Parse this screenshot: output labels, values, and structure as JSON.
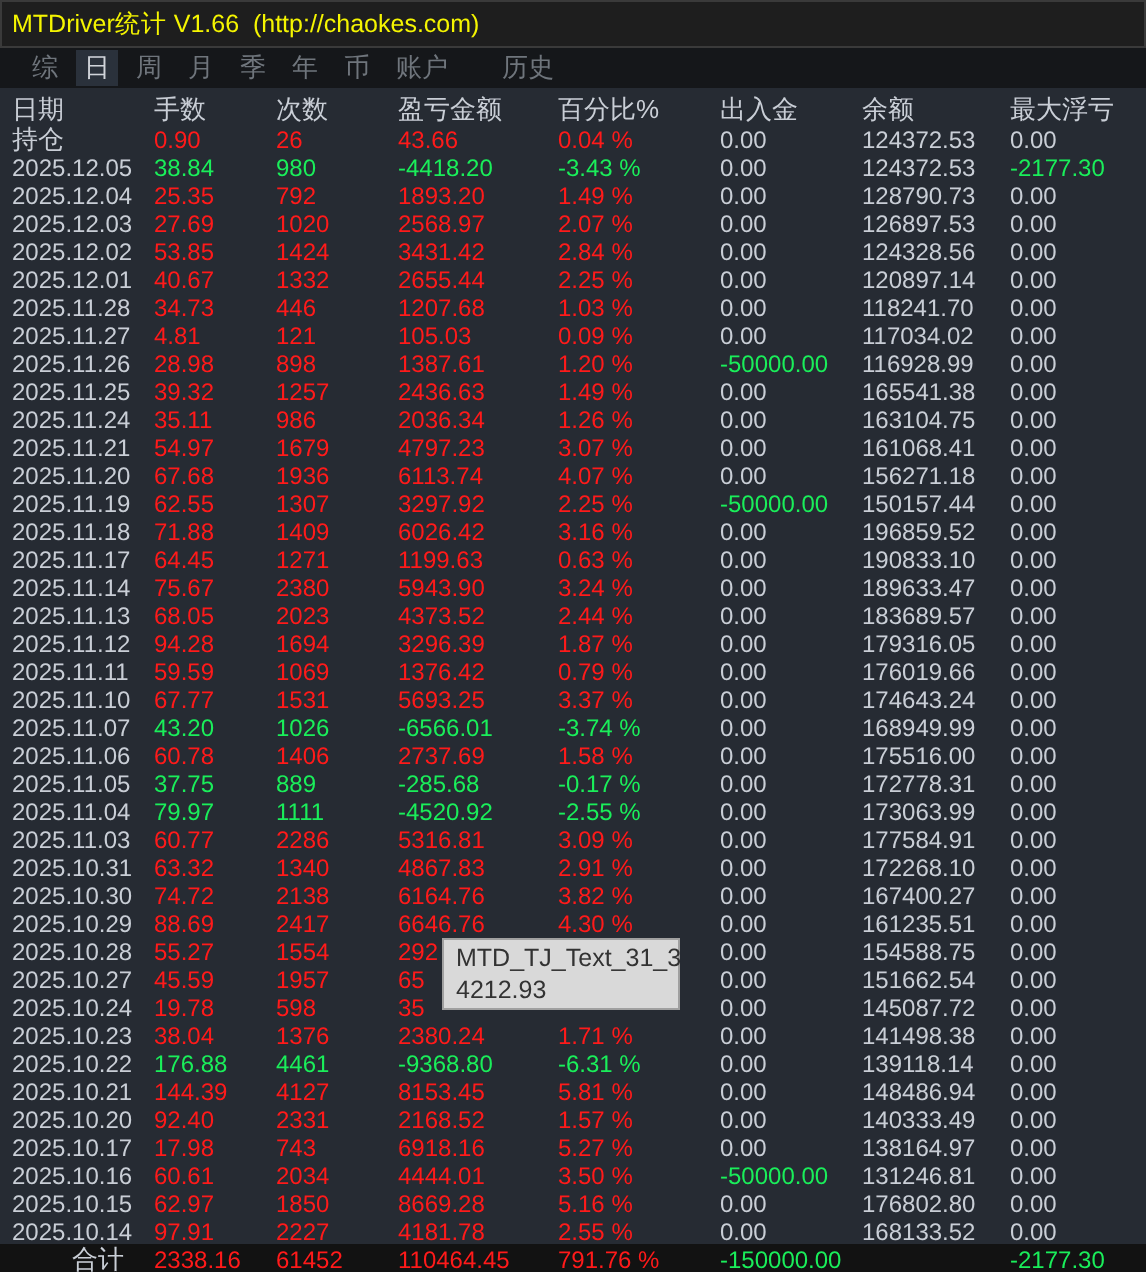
{
  "window": {
    "title": "MTDriver统计 V1.66  (http://chaokes.com)"
  },
  "tabs": [
    {
      "label": "综",
      "selected": false
    },
    {
      "label": "日",
      "selected": true
    },
    {
      "label": "周",
      "selected": false
    },
    {
      "label": "月",
      "selected": false
    },
    {
      "label": "季",
      "selected": false
    },
    {
      "label": "年",
      "selected": false
    },
    {
      "label": "币",
      "selected": false
    },
    {
      "label": "账户",
      "selected": false
    },
    {
      "label": "历史",
      "selected": false
    }
  ],
  "table": {
    "columns": [
      "日期",
      "手数",
      "次数",
      "盈亏金额",
      "百分比%",
      "出入金",
      "余额",
      "最大浮亏"
    ],
    "position": {
      "label": "持仓",
      "lots": "0.90",
      "trades": "26",
      "pnl": "43.66",
      "pct": "0.04 %",
      "cash": "0.00",
      "balance": "124372.53",
      "max_float": "0.00",
      "loss": false
    },
    "rows": [
      {
        "date": "2025.12.05",
        "lots": "38.84",
        "trades": "980",
        "pnl": "-4418.20",
        "pct": "-3.43 %",
        "cash": "0.00",
        "balance": "124372.53",
        "max_float": "-2177.30",
        "loss": true,
        "cash_negative": false,
        "float_negative": true
      },
      {
        "date": "2025.12.04",
        "lots": "25.35",
        "trades": "792",
        "pnl": "1893.20",
        "pct": "1.49 %",
        "cash": "0.00",
        "balance": "128790.73",
        "max_float": "0.00",
        "loss": false,
        "cash_negative": false,
        "float_negative": false
      },
      {
        "date": "2025.12.03",
        "lots": "27.69",
        "trades": "1020",
        "pnl": "2568.97",
        "pct": "2.07 %",
        "cash": "0.00",
        "balance": "126897.53",
        "max_float": "0.00",
        "loss": false,
        "cash_negative": false,
        "float_negative": false
      },
      {
        "date": "2025.12.02",
        "lots": "53.85",
        "trades": "1424",
        "pnl": "3431.42",
        "pct": "2.84 %",
        "cash": "0.00",
        "balance": "124328.56",
        "max_float": "0.00",
        "loss": false,
        "cash_negative": false,
        "float_negative": false
      },
      {
        "date": "2025.12.01",
        "lots": "40.67",
        "trades": "1332",
        "pnl": "2655.44",
        "pct": "2.25 %",
        "cash": "0.00",
        "balance": "120897.14",
        "max_float": "0.00",
        "loss": false,
        "cash_negative": false,
        "float_negative": false
      },
      {
        "date": "2025.11.28",
        "lots": "34.73",
        "trades": "446",
        "pnl": "1207.68",
        "pct": "1.03 %",
        "cash": "0.00",
        "balance": "118241.70",
        "max_float": "0.00",
        "loss": false,
        "cash_negative": false,
        "float_negative": false
      },
      {
        "date": "2025.11.27",
        "lots": "4.81",
        "trades": "121",
        "pnl": "105.03",
        "pct": "0.09 %",
        "cash": "0.00",
        "balance": "117034.02",
        "max_float": "0.00",
        "loss": false,
        "cash_negative": false,
        "float_negative": false
      },
      {
        "date": "2025.11.26",
        "lots": "28.98",
        "trades": "898",
        "pnl": "1387.61",
        "pct": "1.20 %",
        "cash": "-50000.00",
        "balance": "116928.99",
        "max_float": "0.00",
        "loss": false,
        "cash_negative": true,
        "float_negative": false
      },
      {
        "date": "2025.11.25",
        "lots": "39.32",
        "trades": "1257",
        "pnl": "2436.63",
        "pct": "1.49 %",
        "cash": "0.00",
        "balance": "165541.38",
        "max_float": "0.00",
        "loss": false,
        "cash_negative": false,
        "float_negative": false
      },
      {
        "date": "2025.11.24",
        "lots": "35.11",
        "trades": "986",
        "pnl": "2036.34",
        "pct": "1.26 %",
        "cash": "0.00",
        "balance": "163104.75",
        "max_float": "0.00",
        "loss": false,
        "cash_negative": false,
        "float_negative": false
      },
      {
        "date": "2025.11.21",
        "lots": "54.97",
        "trades": "1679",
        "pnl": "4797.23",
        "pct": "3.07 %",
        "cash": "0.00",
        "balance": "161068.41",
        "max_float": "0.00",
        "loss": false,
        "cash_negative": false,
        "float_negative": false
      },
      {
        "date": "2025.11.20",
        "lots": "67.68",
        "trades": "1936",
        "pnl": "6113.74",
        "pct": "4.07 %",
        "cash": "0.00",
        "balance": "156271.18",
        "max_float": "0.00",
        "loss": false,
        "cash_negative": false,
        "float_negative": false
      },
      {
        "date": "2025.11.19",
        "lots": "62.55",
        "trades": "1307",
        "pnl": "3297.92",
        "pct": "2.25 %",
        "cash": "-50000.00",
        "balance": "150157.44",
        "max_float": "0.00",
        "loss": false,
        "cash_negative": true,
        "float_negative": false
      },
      {
        "date": "2025.11.18",
        "lots": "71.88",
        "trades": "1409",
        "pnl": "6026.42",
        "pct": "3.16 %",
        "cash": "0.00",
        "balance": "196859.52",
        "max_float": "0.00",
        "loss": false,
        "cash_negative": false,
        "float_negative": false
      },
      {
        "date": "2025.11.17",
        "lots": "64.45",
        "trades": "1271",
        "pnl": "1199.63",
        "pct": "0.63 %",
        "cash": "0.00",
        "balance": "190833.10",
        "max_float": "0.00",
        "loss": false,
        "cash_negative": false,
        "float_negative": false
      },
      {
        "date": "2025.11.14",
        "lots": "75.67",
        "trades": "2380",
        "pnl": "5943.90",
        "pct": "3.24 %",
        "cash": "0.00",
        "balance": "189633.47",
        "max_float": "0.00",
        "loss": false,
        "cash_negative": false,
        "float_negative": false
      },
      {
        "date": "2025.11.13",
        "lots": "68.05",
        "trades": "2023",
        "pnl": "4373.52",
        "pct": "2.44 %",
        "cash": "0.00",
        "balance": "183689.57",
        "max_float": "0.00",
        "loss": false,
        "cash_negative": false,
        "float_negative": false
      },
      {
        "date": "2025.11.12",
        "lots": "94.28",
        "trades": "1694",
        "pnl": "3296.39",
        "pct": "1.87 %",
        "cash": "0.00",
        "balance": "179316.05",
        "max_float": "0.00",
        "loss": false,
        "cash_negative": false,
        "float_negative": false
      },
      {
        "date": "2025.11.11",
        "lots": "59.59",
        "trades": "1069",
        "pnl": "1376.42",
        "pct": "0.79 %",
        "cash": "0.00",
        "balance": "176019.66",
        "max_float": "0.00",
        "loss": false,
        "cash_negative": false,
        "float_negative": false
      },
      {
        "date": "2025.11.10",
        "lots": "67.77",
        "trades": "1531",
        "pnl": "5693.25",
        "pct": "3.37 %",
        "cash": "0.00",
        "balance": "174643.24",
        "max_float": "0.00",
        "loss": false,
        "cash_negative": false,
        "float_negative": false
      },
      {
        "date": "2025.11.07",
        "lots": "43.20",
        "trades": "1026",
        "pnl": "-6566.01",
        "pct": "-3.74 %",
        "cash": "0.00",
        "balance": "168949.99",
        "max_float": "0.00",
        "loss": true,
        "cash_negative": false,
        "float_negative": false
      },
      {
        "date": "2025.11.06",
        "lots": "60.78",
        "trades": "1406",
        "pnl": "2737.69",
        "pct": "1.58 %",
        "cash": "0.00",
        "balance": "175516.00",
        "max_float": "0.00",
        "loss": false,
        "cash_negative": false,
        "float_negative": false
      },
      {
        "date": "2025.11.05",
        "lots": "37.75",
        "trades": "889",
        "pnl": "-285.68",
        "pct": "-0.17 %",
        "cash": "0.00",
        "balance": "172778.31",
        "max_float": "0.00",
        "loss": true,
        "cash_negative": false,
        "float_negative": false
      },
      {
        "date": "2025.11.04",
        "lots": "79.97",
        "trades": "1111",
        "pnl": "-4520.92",
        "pct": "-2.55 %",
        "cash": "0.00",
        "balance": "173063.99",
        "max_float": "0.00",
        "loss": true,
        "cash_negative": false,
        "float_negative": false
      },
      {
        "date": "2025.11.03",
        "lots": "60.77",
        "trades": "2286",
        "pnl": "5316.81",
        "pct": "3.09 %",
        "cash": "0.00",
        "balance": "177584.91",
        "max_float": "0.00",
        "loss": false,
        "cash_negative": false,
        "float_negative": false
      },
      {
        "date": "2025.10.31",
        "lots": "63.32",
        "trades": "1340",
        "pnl": "4867.83",
        "pct": "2.91 %",
        "cash": "0.00",
        "balance": "172268.10",
        "max_float": "0.00",
        "loss": false,
        "cash_negative": false,
        "float_negative": false
      },
      {
        "date": "2025.10.30",
        "lots": "74.72",
        "trades": "2138",
        "pnl": "6164.76",
        "pct": "3.82 %",
        "cash": "0.00",
        "balance": "167400.27",
        "max_float": "0.00",
        "loss": false,
        "cash_negative": false,
        "float_negative": false
      },
      {
        "date": "2025.10.29",
        "lots": "88.69",
        "trades": "2417",
        "pnl": "6646.76",
        "pct": "4.30 %",
        "cash": "0.00",
        "balance": "161235.51",
        "max_float": "0.00",
        "loss": false,
        "cash_negative": false,
        "float_negative": false
      },
      {
        "date": "2025.10.28",
        "lots": "55.27",
        "trades": "1554",
        "pnl": "292",
        "cash": "0.00",
        "balance": "154588.75",
        "max_float": "0.00",
        "loss": false,
        "cash_negative": false,
        "float_negative": false
      },
      {
        "date": "2025.10.27",
        "lots": "45.59",
        "trades": "1957",
        "pnl": "65",
        "cash": "0.00",
        "balance": "151662.54",
        "max_float": "0.00",
        "loss": false,
        "cash_negative": false,
        "float_negative": false
      },
      {
        "date": "2025.10.24",
        "lots": "19.78",
        "trades": "598",
        "pnl": "35",
        "cash": "0.00",
        "balance": "145087.72",
        "max_float": "0.00",
        "loss": false,
        "cash_negative": false,
        "float_negative": false
      },
      {
        "date": "2025.10.23",
        "lots": "38.04",
        "trades": "1376",
        "pnl": "2380.24",
        "pct": "1.71 %",
        "cash": "0.00",
        "balance": "141498.38",
        "max_float": "0.00",
        "loss": false,
        "cash_negative": false,
        "float_negative": false
      },
      {
        "date": "2025.10.22",
        "lots": "176.88",
        "trades": "4461",
        "pnl": "-9368.80",
        "pct": "-6.31 %",
        "cash": "0.00",
        "balance": "139118.14",
        "max_float": "0.00",
        "loss": true,
        "cash_negative": false,
        "float_negative": false
      },
      {
        "date": "2025.10.21",
        "lots": "144.39",
        "trades": "4127",
        "pnl": "8153.45",
        "pct": "5.81 %",
        "cash": "0.00",
        "balance": "148486.94",
        "max_float": "0.00",
        "loss": false,
        "cash_negative": false,
        "float_negative": false
      },
      {
        "date": "2025.10.20",
        "lots": "92.40",
        "trades": "2331",
        "pnl": "2168.52",
        "pct": "1.57 %",
        "cash": "0.00",
        "balance": "140333.49",
        "max_float": "0.00",
        "loss": false,
        "cash_negative": false,
        "float_negative": false
      },
      {
        "date": "2025.10.17",
        "lots": "17.98",
        "trades": "743",
        "pnl": "6918.16",
        "pct": "5.27 %",
        "cash": "0.00",
        "balance": "138164.97",
        "max_float": "0.00",
        "loss": false,
        "cash_negative": false,
        "float_negative": false
      },
      {
        "date": "2025.10.16",
        "lots": "60.61",
        "trades": "2034",
        "pnl": "4444.01",
        "pct": "3.50 %",
        "cash": "-50000.00",
        "balance": "131246.81",
        "max_float": "0.00",
        "loss": false,
        "cash_negative": true,
        "float_negative": false
      },
      {
        "date": "2025.10.15",
        "lots": "62.97",
        "trades": "1850",
        "pnl": "8669.28",
        "pct": "5.16 %",
        "cash": "0.00",
        "balance": "176802.80",
        "max_float": "0.00",
        "loss": false,
        "cash_negative": false,
        "float_negative": false
      },
      {
        "date": "2025.10.14",
        "lots": "97.91",
        "trades": "2227",
        "pnl": "4181.78",
        "pct": "2.55 %",
        "cash": "0.00",
        "balance": "168133.52",
        "max_float": "0.00",
        "loss": false,
        "cash_negative": false,
        "float_negative": false
      }
    ],
    "total": {
      "label": "合计",
      "lots": "2338.16",
      "trades": "61452",
      "pnl": "110464.45",
      "pct": "791.76 %",
      "cash": "-150000.00",
      "max_float": "-2177.30"
    }
  },
  "tooltip": {
    "title": "MTD_TJ_Text_31_3",
    "value": "4212.93"
  }
}
